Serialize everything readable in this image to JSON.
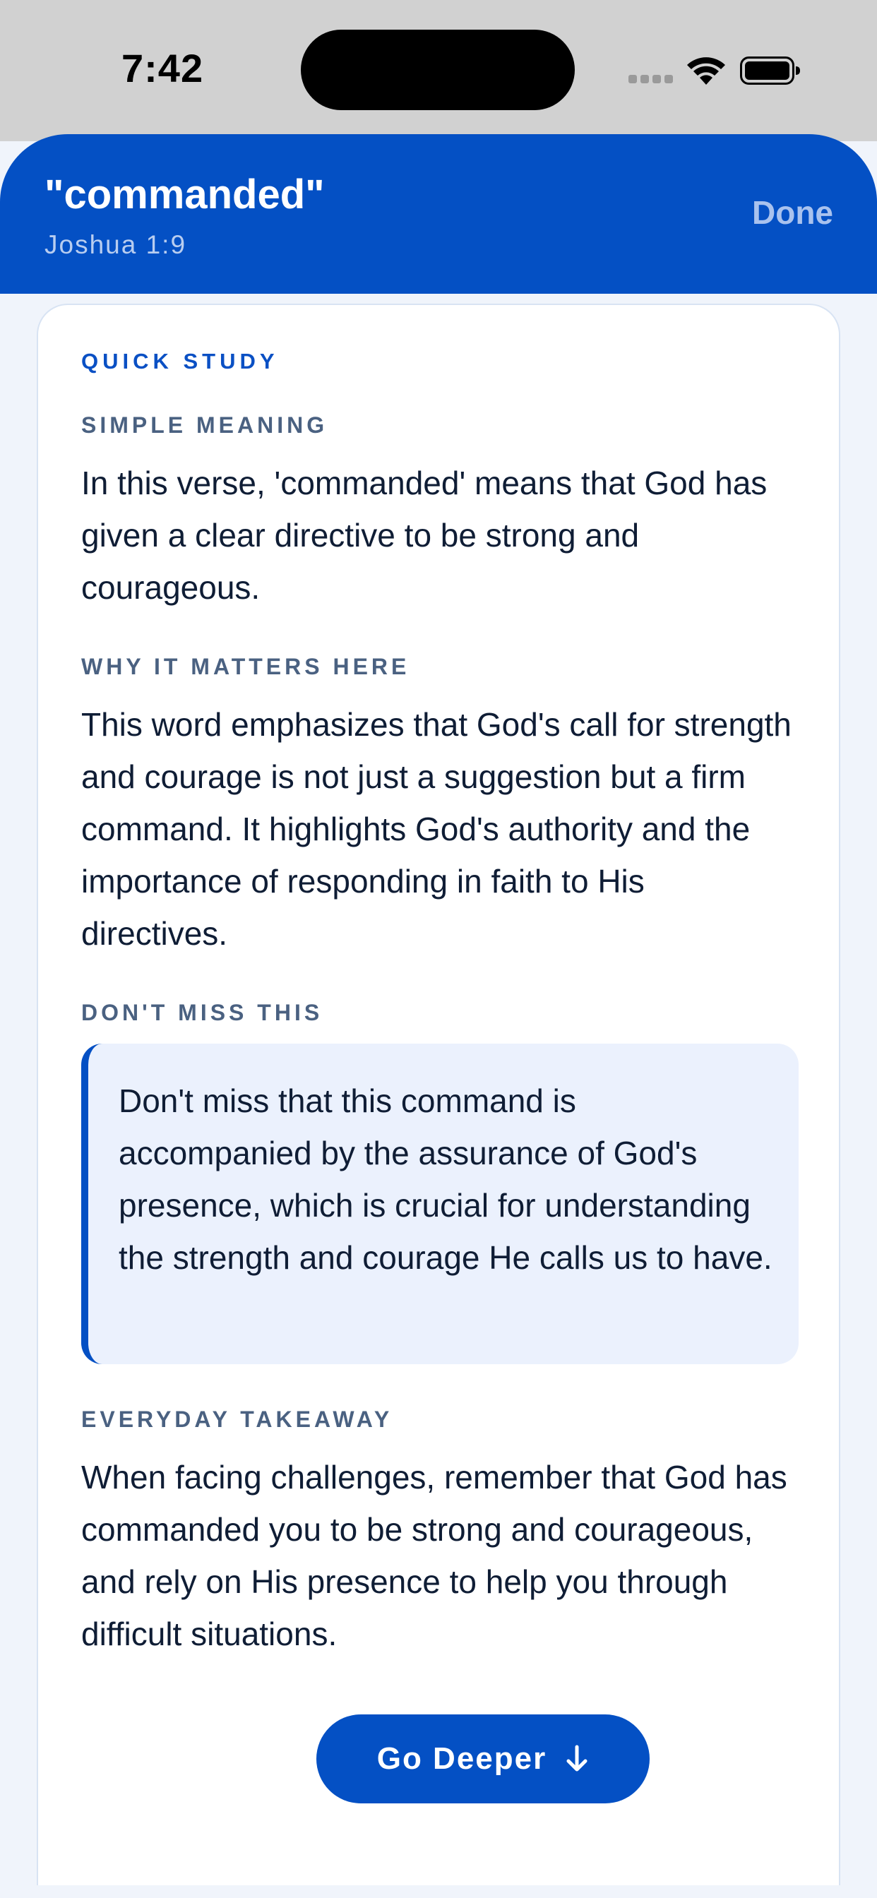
{
  "status_bar": {
    "time": "7:42",
    "icons": [
      "cellular-signal-icon",
      "wifi-icon",
      "battery-icon"
    ]
  },
  "header": {
    "title": "\"commanded\"",
    "subtitle": "Joshua 1:9",
    "done_label": "Done"
  },
  "study": {
    "kicker": "QUICK STUDY",
    "sections": [
      {
        "label": "SIMPLE MEANING",
        "text": "In this verse, 'commanded' means that God has given a clear directive to be strong and courageous."
      },
      {
        "label": "WHY IT MATTERS HERE",
        "text": "This word emphasizes that God's call for strength and courage is not just a suggestion but a firm command. It highlights God's authority and the importance of responding in faith to His directives."
      },
      {
        "label": "DON'T MISS THIS",
        "text": "Don't miss that this command is accompanied by the assurance of God's presence, which is crucial for understanding the strength and courage He calls us to have."
      },
      {
        "label": "EVERYDAY TAKEAWAY",
        "text": "When facing challenges, remember that God has commanded you to be strong and courageous, and rely on His presence to help you through difficult situations."
      }
    ],
    "go_deeper_label": "Go Deeper",
    "go_deeper_icon": "arrow-down-icon"
  },
  "colors": {
    "accent": "#0450c4",
    "callout_bg": "#ebf1fd",
    "label": "#4a6181",
    "page_bg": "#f0f4fb"
  }
}
